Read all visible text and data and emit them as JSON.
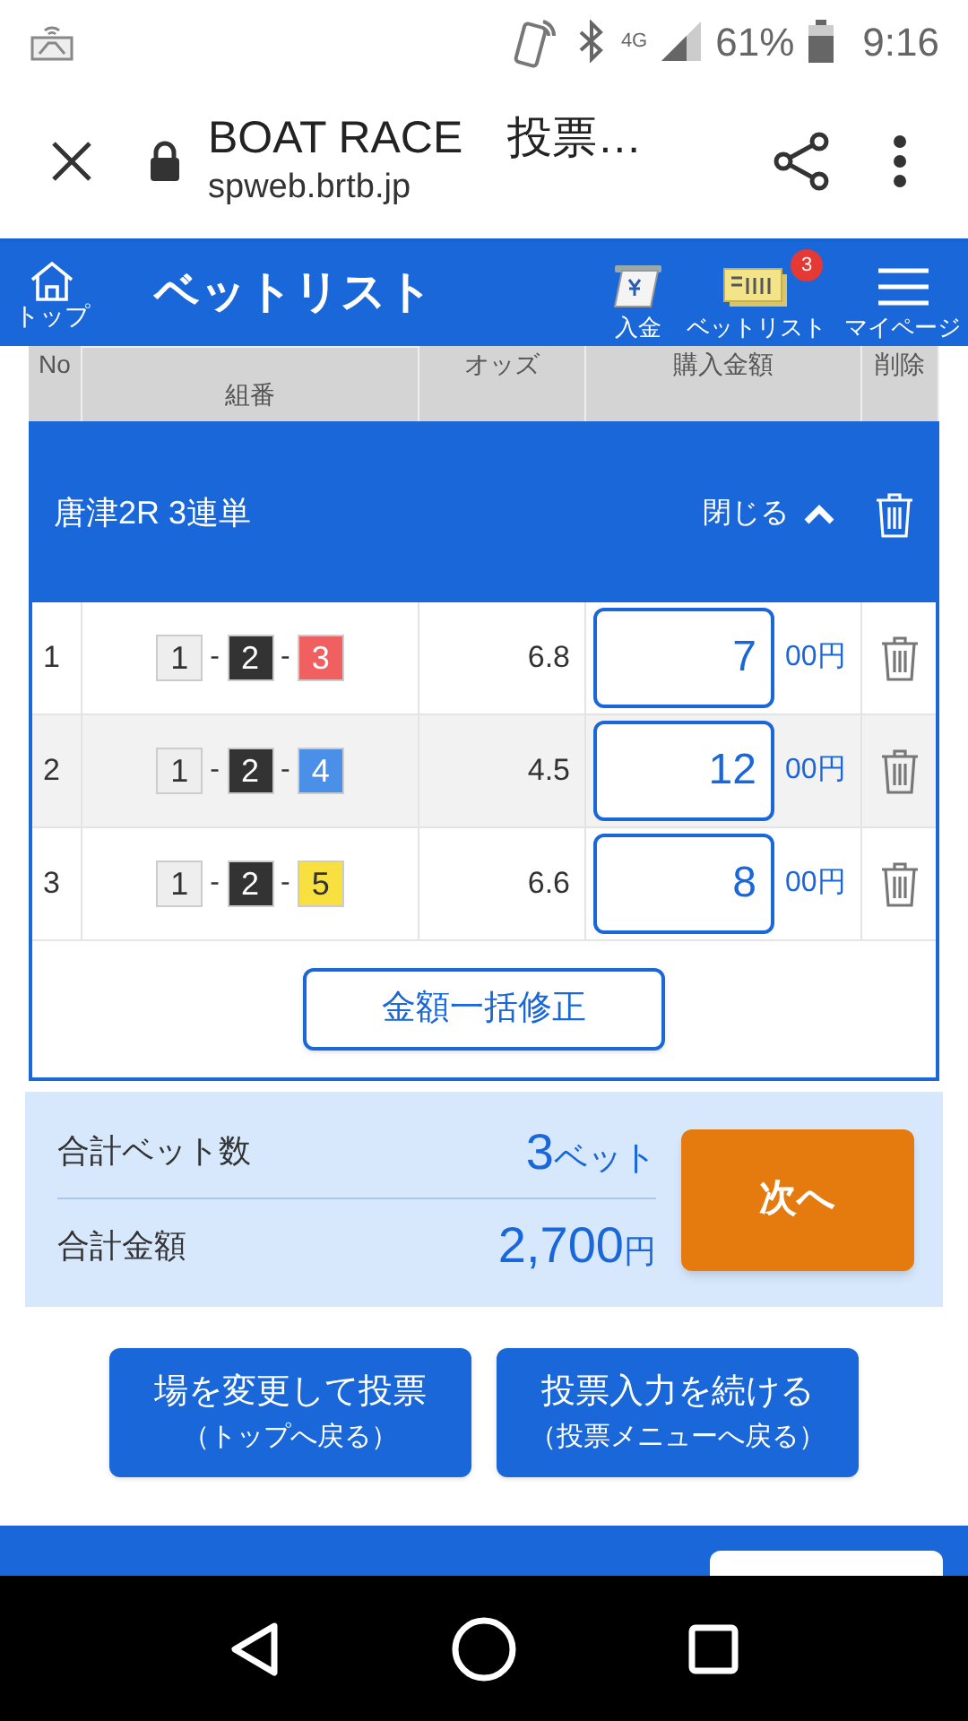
{
  "status_bar": {
    "network": "4G",
    "battery": "61%",
    "time": "9:16"
  },
  "browser": {
    "title": "BOAT RACE　投票…",
    "url": "spweb.brtb.jp"
  },
  "nav": {
    "home": "トップ",
    "title": "ベットリスト",
    "items": [
      {
        "label": "入金",
        "kind": "deposit"
      },
      {
        "label": "ベットリスト",
        "kind": "betlist",
        "badge": "3"
      },
      {
        "label": "マイページ",
        "kind": "menu"
      }
    ]
  },
  "table": {
    "columns": [
      "No",
      "組番",
      "オッズ",
      "購入金額",
      "削除"
    ],
    "group": {
      "title": "唐津2R 3連単",
      "toggle": "閉じる",
      "expanded": true
    },
    "rows": [
      {
        "no": "1",
        "combo": [
          {
            "num": "1",
            "color": "#eeeeee"
          },
          {
            "num": "2",
            "color": "#333333"
          },
          {
            "num": "3",
            "color": "#f06060"
          }
        ],
        "odds": "6.8",
        "amount": "7",
        "unit": "00円"
      },
      {
        "no": "2",
        "combo": [
          {
            "num": "1",
            "color": "#eeeeee"
          },
          {
            "num": "2",
            "color": "#333333"
          },
          {
            "num": "4",
            "color": "#4a90e8"
          }
        ],
        "odds": "4.5",
        "amount": "12",
        "unit": "00円"
      },
      {
        "no": "3",
        "combo": [
          {
            "num": "1",
            "color": "#eeeeee"
          },
          {
            "num": "2",
            "color": "#333333"
          },
          {
            "num": "5",
            "color": "#f8e040"
          }
        ],
        "odds": "6.6",
        "amount": "8",
        "unit": "00円"
      }
    ],
    "combo_separator": "-",
    "bulk_button": "金額一括修正"
  },
  "summary": {
    "count_label": "合計ベット数",
    "count": "3",
    "count_unit": "ベット",
    "total_label": "合計金額",
    "total": "2,700",
    "total_unit": "円",
    "next": "次へ"
  },
  "buttons": [
    {
      "label": "場を変更して投票",
      "sub": "（トップへ戻る）"
    },
    {
      "label": "投票入力を続ける",
      "sub": "（投票メニューへ戻る）"
    }
  ]
}
